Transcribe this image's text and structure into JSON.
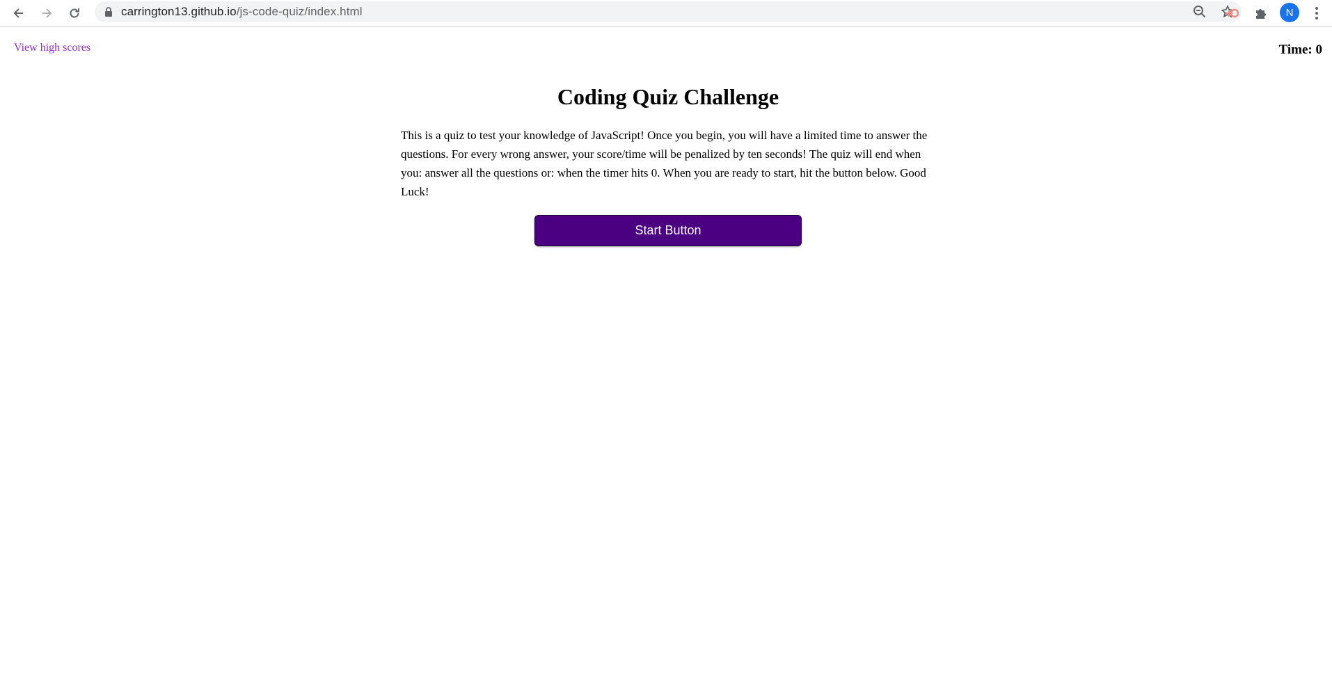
{
  "browser": {
    "url_domain": "carrington13.github.io",
    "url_path": "/js-code-quiz/index.html",
    "profile_initial": "N"
  },
  "page": {
    "high_scores_link": "View high scores",
    "timer_label": "Time:",
    "timer_value": "0",
    "title": "Coding Quiz Challenge",
    "intro": "This is a quiz to test your knowledge of JavaScript! Once you begin, you will have a limited time to answer the questions. For every wrong answer, your score/time will be penalized by ten seconds! The quiz will end when you: answer all the questions or: when the timer hits 0. When you are ready to start, hit the button below. Good Luck!",
    "start_button": "Start Button"
  },
  "colors": {
    "accent_button": "#4b0082",
    "link": "#8e2dc5"
  }
}
